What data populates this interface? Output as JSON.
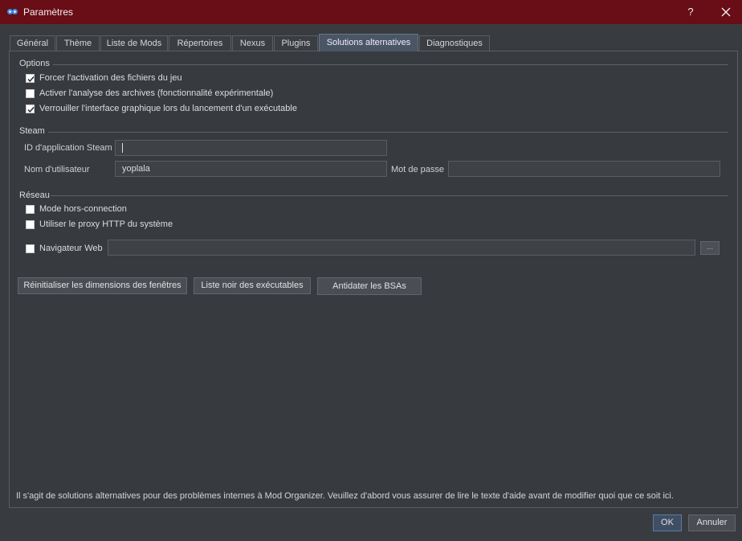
{
  "window": {
    "title": "Paramètres",
    "help_label": "?",
    "close_label": "✕"
  },
  "tabs": [
    {
      "label": "Général"
    },
    {
      "label": "Thème"
    },
    {
      "label": "Liste de Mods"
    },
    {
      "label": "Répertoires"
    },
    {
      "label": "Nexus"
    },
    {
      "label": "Plugins"
    },
    {
      "label": "Solutions alternatives",
      "active": true
    },
    {
      "label": "Diagnostiques"
    }
  ],
  "options": {
    "title": "Options",
    "items": [
      {
        "label": "Forcer l'activation des fichiers du jeu",
        "checked": true
      },
      {
        "label": "Activer l'analyse des archives (fonctionnalité expérimentale)",
        "checked": false
      },
      {
        "label": "Verrouiller l'interface graphique lors du lancement d'un exécutable",
        "checked": true
      }
    ]
  },
  "steam": {
    "title": "Steam",
    "app_id_label": "ID d'application Steam",
    "app_id_value": "",
    "username_label": "Nom d'utilisateur",
    "username_value": "yoplala",
    "password_label": "Mot de passe",
    "password_value": ""
  },
  "network": {
    "title": "Réseau",
    "offline_label": "Mode hors-connection",
    "offline_checked": false,
    "proxy_label": "Utiliser le proxy HTTP du système",
    "proxy_checked": false,
    "browser_label": "Navigateur Web",
    "browser_checked": false,
    "browser_value": "",
    "browse_button": "..."
  },
  "actions": {
    "reset_windows": "Réinitialiser les dimensions des fenêtres",
    "exec_blacklist": "Liste noir des exécutables",
    "backdate_bsa": "Antidater les BSAs"
  },
  "help_text": "Il s'agit de solutions alternatives pour des problèmes internes à Mod Organizer. Veuillez d'abord vous assurer de lire le texte d'aide avant de modifier quoi que ce soit ici.",
  "footer": {
    "ok": "OK",
    "cancel": "Annuler"
  },
  "colors": {
    "titlebar": "#690d16",
    "background": "#383c41",
    "active_tab": "#4a5565"
  }
}
